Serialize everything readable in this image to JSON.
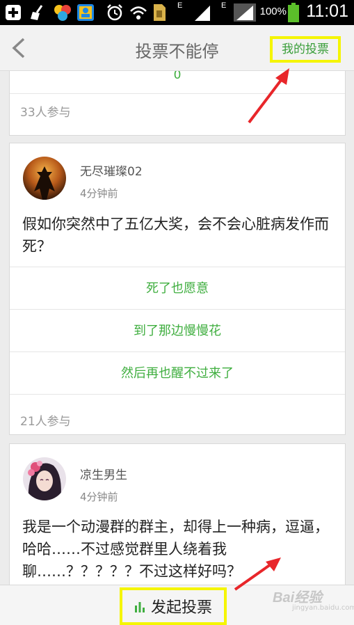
{
  "status_bar": {
    "network_e1": "E",
    "network_e2": "E",
    "battery": "100%",
    "time": "11:01"
  },
  "header": {
    "title": "投票不能停",
    "my_votes_label": "我的投票"
  },
  "cards": [
    {
      "partial_option": "0",
      "participants": "33人参与"
    },
    {
      "username": "无尽璀璨02",
      "time_ago": "4分钟前",
      "question": "假如你突然中了五亿大奖，会不会心脏病发作而死？",
      "options": [
        "死了也愿意",
        "到了那边慢慢花",
        "然后再也醒不过来了"
      ],
      "participants": "21人参与"
    },
    {
      "username": "凉生男生",
      "time_ago": "4分钟前",
      "question": "我是一个动漫群的群主，却得上一种病，逗逼，哈哈……不过感觉群里人绕着我聊……？？？？？不过这样好吗？"
    }
  ],
  "bottom_bar": {
    "start_vote_label": "发起投票"
  },
  "watermark": {
    "brand": "Bai",
    "brand2": "经验",
    "url": "jingyan.baidu.com"
  },
  "colors": {
    "accent_green": "#3fae3f",
    "highlight_yellow": "#f5f500",
    "arrow_red": "#e8262a"
  }
}
